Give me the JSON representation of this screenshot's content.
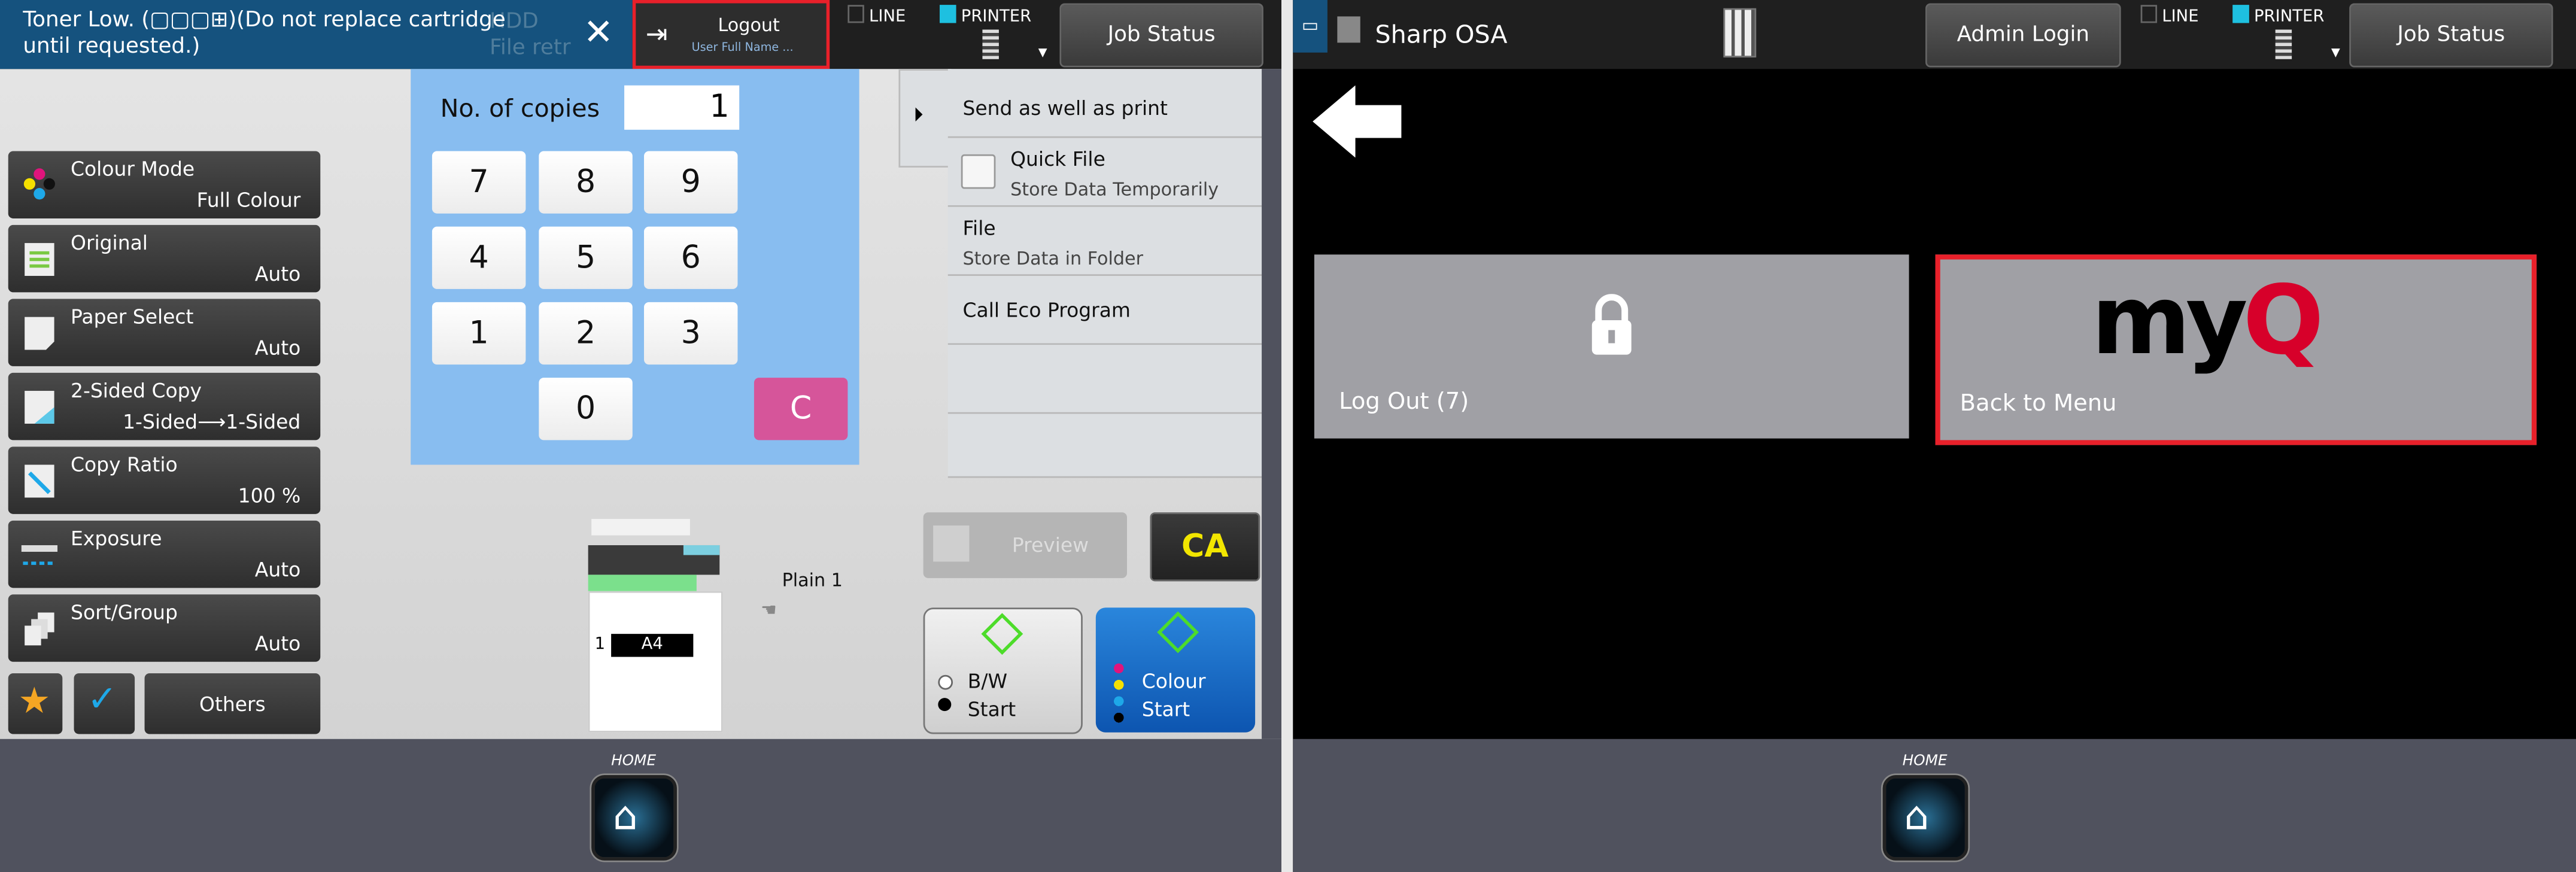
{
  "left": {
    "notice": "Toner Low. (▢▢▢⊞)(Do not replace cartridge until requested.)",
    "notice_bg_hidden": [
      "HDD",
      "File retrieve"
    ],
    "logout": {
      "label": "Logout",
      "user": "User Full Name ..."
    },
    "status": {
      "line": "LINE",
      "printer": "PRINTER"
    },
    "job_status": "Job Status",
    "copies": {
      "label": "No. of copies",
      "value": "1"
    },
    "keys": [
      "7",
      "8",
      "9",
      "4",
      "5",
      "6",
      "1",
      "2",
      "3",
      "0"
    ],
    "clear": "C",
    "menu": [
      {
        "title": "Colour Mode",
        "value": "Full Colour",
        "icon": "colour-dots-icon"
      },
      {
        "title": "Original",
        "value": "Auto",
        "icon": "original-document-icon"
      },
      {
        "title": "Paper Select",
        "value": "Auto",
        "icon": "paper-icon"
      },
      {
        "title": "2-Sided Copy",
        "value": "1-Sided⟶1-Sided",
        "icon": "duplex-icon"
      },
      {
        "title": "Copy Ratio",
        "value": "100 %",
        "icon": "ratio-icon"
      },
      {
        "title": "Exposure",
        "value": "Auto",
        "icon": "exposure-icon"
      },
      {
        "title": "Sort/Group",
        "value": "Auto",
        "icon": "sort-icon"
      }
    ],
    "others": "Others",
    "side_list": [
      {
        "main": "Send as well as print"
      },
      {
        "main": "Quick File",
        "sub": "Store Data Temporarily"
      },
      {
        "main": "File",
        "sub": "Store Data in Folder"
      },
      {
        "main": "Call Eco Program"
      }
    ],
    "tray": {
      "label": "Plain 1",
      "number": "1",
      "size": "A4"
    },
    "preview": "Preview",
    "ca": "CA",
    "bw_start": {
      "line1": "B/W",
      "line2": "Start"
    },
    "colour_start": {
      "line1": "Colour",
      "line2": "Start"
    },
    "home": "HOME"
  },
  "right": {
    "app_title": "Sharp OSA",
    "admin_login": "Admin Login",
    "status": {
      "line": "LINE",
      "printer": "PRINTER"
    },
    "job_status": "Job Status",
    "logout_tile": "Log Out (7)",
    "menu_tile": "Back to Menu",
    "logo": "myQ",
    "home": "HOME"
  },
  "colors": {
    "highlight": "#e8202a",
    "keypad_bg": "#88bdf0",
    "clear": "#d6559a",
    "colour_start": "#1a6fc9",
    "ca_text": "#f2e600",
    "myq_red": "#d7002a"
  }
}
